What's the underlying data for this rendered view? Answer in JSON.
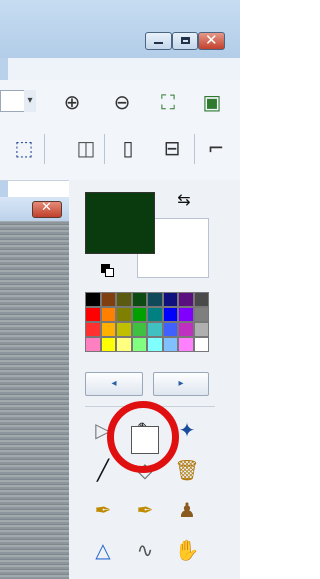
{
  "window": {
    "minimize_icon": "minimize-icon",
    "maximize_icon": "maximize-icon",
    "close_icon": "close-icon",
    "close_color": "#c8442f"
  },
  "toolbar1": {
    "icons": [
      {
        "name": "dropdown-arrow-icon",
        "glyph": "▾"
      },
      {
        "name": "zoom-in-icon",
        "glyph": "⊕"
      },
      {
        "name": "zoom-out-icon",
        "glyph": "⊖"
      },
      {
        "name": "fit-window-icon",
        "glyph": "⛶"
      },
      {
        "name": "actual-size-icon",
        "glyph": "▣"
      }
    ]
  },
  "toolbar2": {
    "icons": [
      {
        "name": "select-area-icon",
        "glyph": "⬚"
      },
      {
        "name": "flip-icon",
        "glyph": "◫"
      },
      {
        "name": "columns-icon",
        "glyph": "▯"
      },
      {
        "name": "rows-icon",
        "glyph": "⊟"
      },
      {
        "name": "crop-icon",
        "glyph": "⌐"
      }
    ]
  },
  "colors": {
    "primary": "#0a3b0f",
    "secondary": "#ffffff",
    "swap_icon": "swap-colors-icon",
    "reset_icon": "default-colors-icon",
    "palette": [
      "#000000",
      "#7f3f10",
      "#5a5a10",
      "#0e4a14",
      "#104a5a",
      "#10107f",
      "#5a107f",
      "#4a4a4a",
      "#ff0000",
      "#ff7f00",
      "#7f7f00",
      "#00a000",
      "#008080",
      "#0000ff",
      "#7f00ff",
      "#7f7f7f",
      "#ff3030",
      "#ffb000",
      "#c0c000",
      "#40c040",
      "#40c0c0",
      "#4060ff",
      "#c030c0",
      "#b0b0b0",
      "#ff80c0",
      "#ffff00",
      "#ffff80",
      "#80ff80",
      "#80ffff",
      "#80c0ff",
      "#ff80ff",
      "#ffffff"
    ],
    "prev_icon": "palette-prev-icon",
    "next_icon": "palette-next-icon"
  },
  "tools": [
    {
      "name": "arrow-tool-icon",
      "glyph": "▷"
    },
    {
      "name": "color-picker-tool-icon",
      "glyph": "✎"
    },
    {
      "name": "magic-wand-tool-icon",
      "glyph": "✦"
    },
    {
      "name": "line-tool-icon",
      "glyph": "╱"
    },
    {
      "name": "eraser-tool-icon",
      "glyph": "◇"
    },
    {
      "name": "spray-tool-icon",
      "glyph": "🗑"
    },
    {
      "name": "brush-tool-icon",
      "glyph": "✒"
    },
    {
      "name": "brush-plus-tool-icon",
      "glyph": "✒"
    },
    {
      "name": "stamp-tool-icon",
      "glyph": "♟"
    },
    {
      "name": "drop-tool-icon",
      "glyph": "△"
    },
    {
      "name": "smudge-tool-icon",
      "glyph": "∿"
    },
    {
      "name": "hand-tool-icon",
      "glyph": "✋"
    }
  ],
  "highlight_color": "#e01010"
}
